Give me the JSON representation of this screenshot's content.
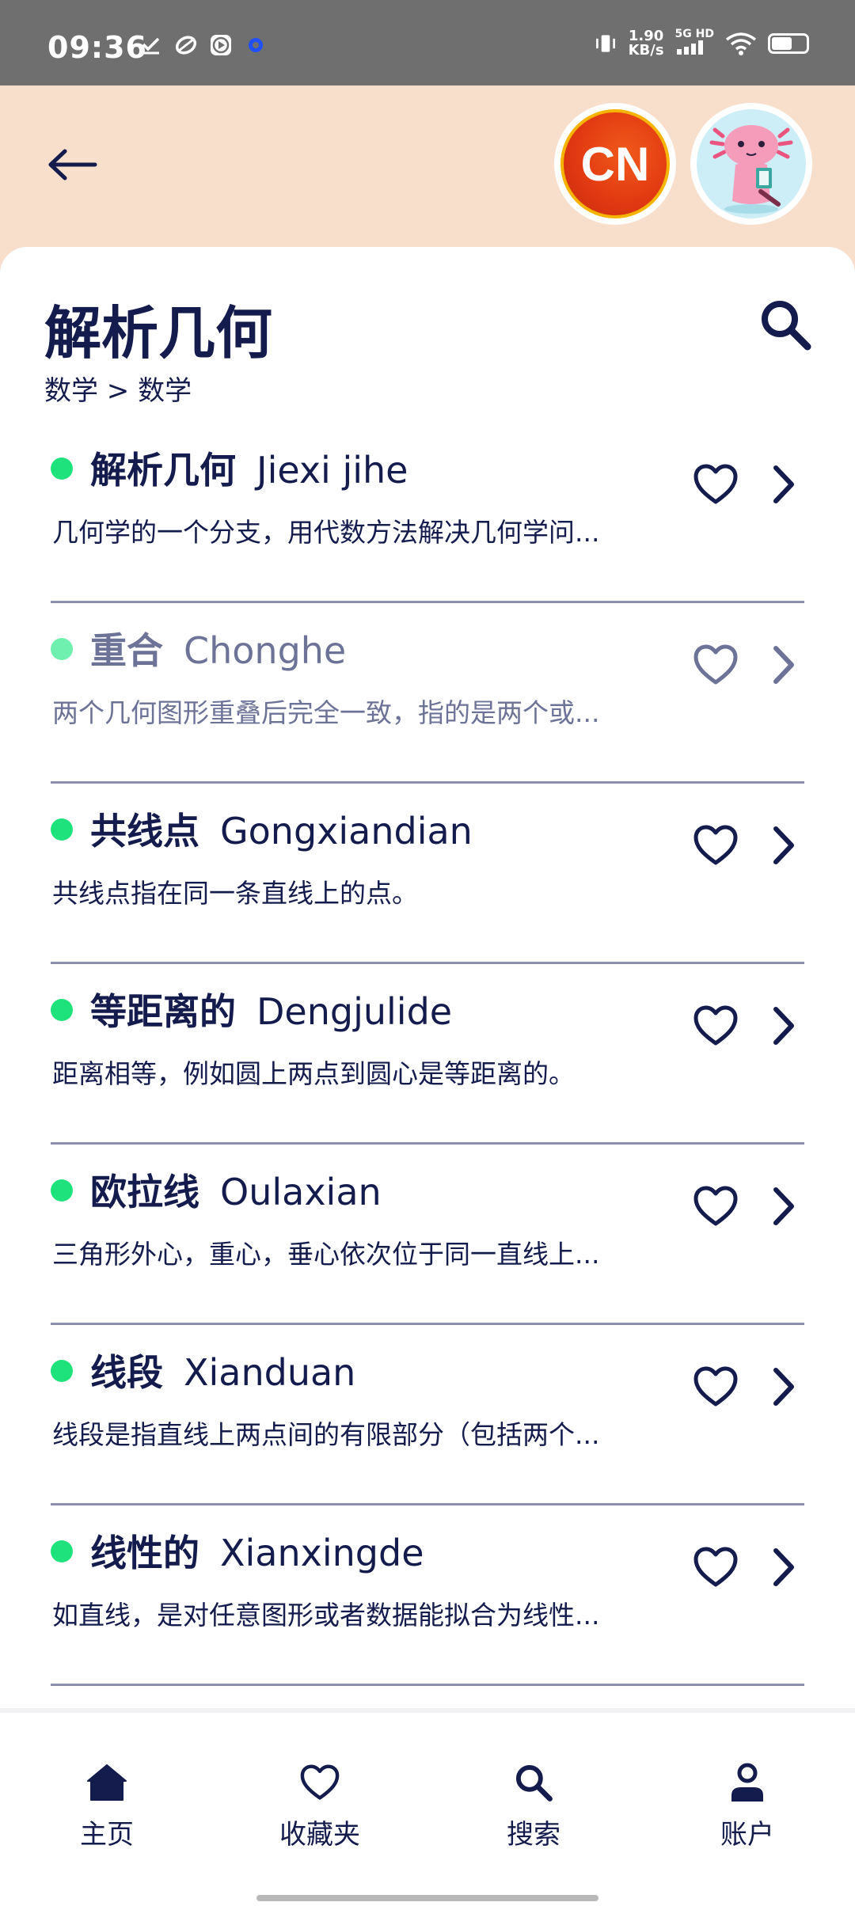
{
  "status_bar": {
    "time": "09:36",
    "net_speed_value": "1.90",
    "net_speed_unit": "KB/s",
    "network_gen": "5G HD",
    "battery_level": 0.55,
    "icons": [
      "check-download-icon",
      "sync-icon",
      "play-icon",
      "dot-icon",
      "vibrate-icon",
      "signal-icon",
      "wifi-icon",
      "battery-icon"
    ]
  },
  "header": {
    "back_icon": "arrow-left-icon",
    "language_badge": "CN",
    "profile_avatar": "axolotl-avatar"
  },
  "page": {
    "title": "解析几何",
    "breadcrumb": "数学 > 数学"
  },
  "items": [
    {
      "title": "解析几何",
      "pinyin": "Jiexi jihe",
      "desc": "几何学的一个分支，用代数方法解决几何学问..."
    },
    {
      "title": "重合",
      "pinyin": "Chonghe",
      "desc": "两个几何图形重叠后完全一致，指的是两个或..."
    },
    {
      "title": "共线点",
      "pinyin": "Gongxiandian",
      "desc": "共线点指在同一条直线上的点。"
    },
    {
      "title": "等距离的",
      "pinyin": "Dengjulide",
      "desc": "距离相等，例如圆上两点到圆心是等距离的。"
    },
    {
      "title": "欧拉线",
      "pinyin": "Oulaxian",
      "desc": "三角形外心，重心，垂心依次位于同一直线上..."
    },
    {
      "title": "线段",
      "pinyin": "Xianduan",
      "desc": "线段是指直线上两点间的有限部分（包括两个..."
    },
    {
      "title": "线性的",
      "pinyin": "Xianxingde",
      "desc": "如直线，是对任意图形或者数据能拟合为线性..."
    }
  ],
  "nav": {
    "home": "主页",
    "favorites": "收藏夹",
    "search": "搜索",
    "account": "账户"
  },
  "colors": {
    "accent_dot": "#1ee37c",
    "navy": "#141b4d",
    "header_bg": "#f8dfcb"
  }
}
